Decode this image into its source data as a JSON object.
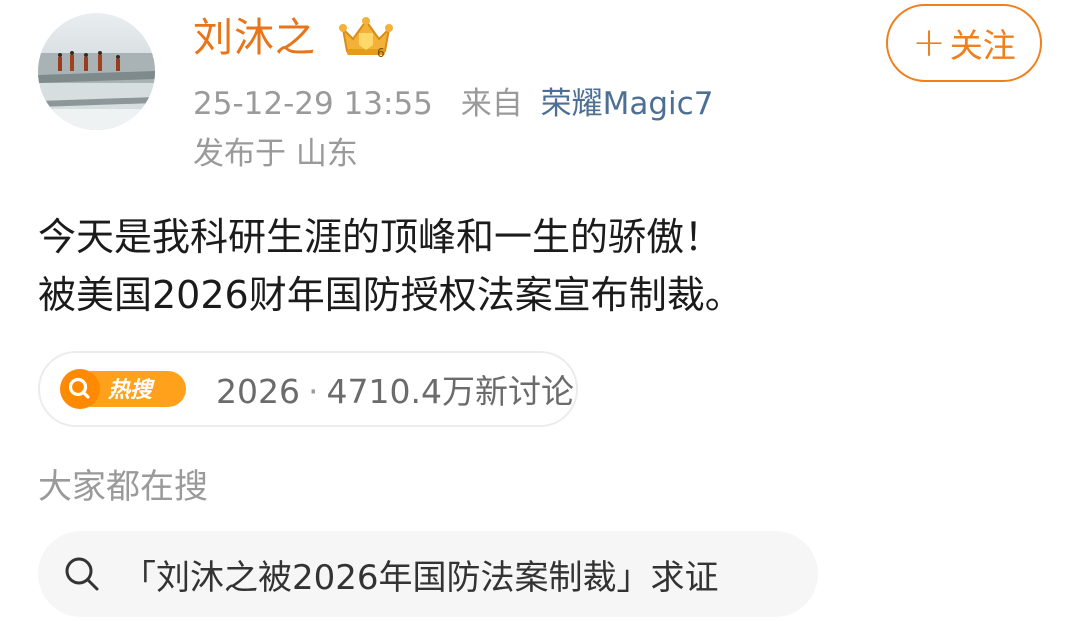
{
  "post": {
    "author": {
      "name": "刘沐之",
      "badge_level": "6",
      "avatar_icon": "avatar-waterfall-monks-image"
    },
    "follow_label": "关注",
    "meta": {
      "date": "25-12-29 13:55",
      "from_label": "来自",
      "device": "荣耀Magic7",
      "location_label": "发布于 山东"
    },
    "text_lines": [
      "今天是我科研生涯的顶峰和一生的骄傲！",
      "被美国2026财年国防授权法案宣布制裁。"
    ],
    "hot_search": {
      "badge_label": "热搜",
      "topic": "2026",
      "separator": "·",
      "discussion": "4710.4万新讨论"
    }
  },
  "related": {
    "section_label": "大家都在搜",
    "suggestion": "「刘沐之被2026年国防法案制裁」求证"
  },
  "colors": {
    "accent_orange": "#f07f1c",
    "username_orange": "#e8751a",
    "device_blue": "#4d6f95",
    "meta_gray": "#9a9a9a"
  }
}
